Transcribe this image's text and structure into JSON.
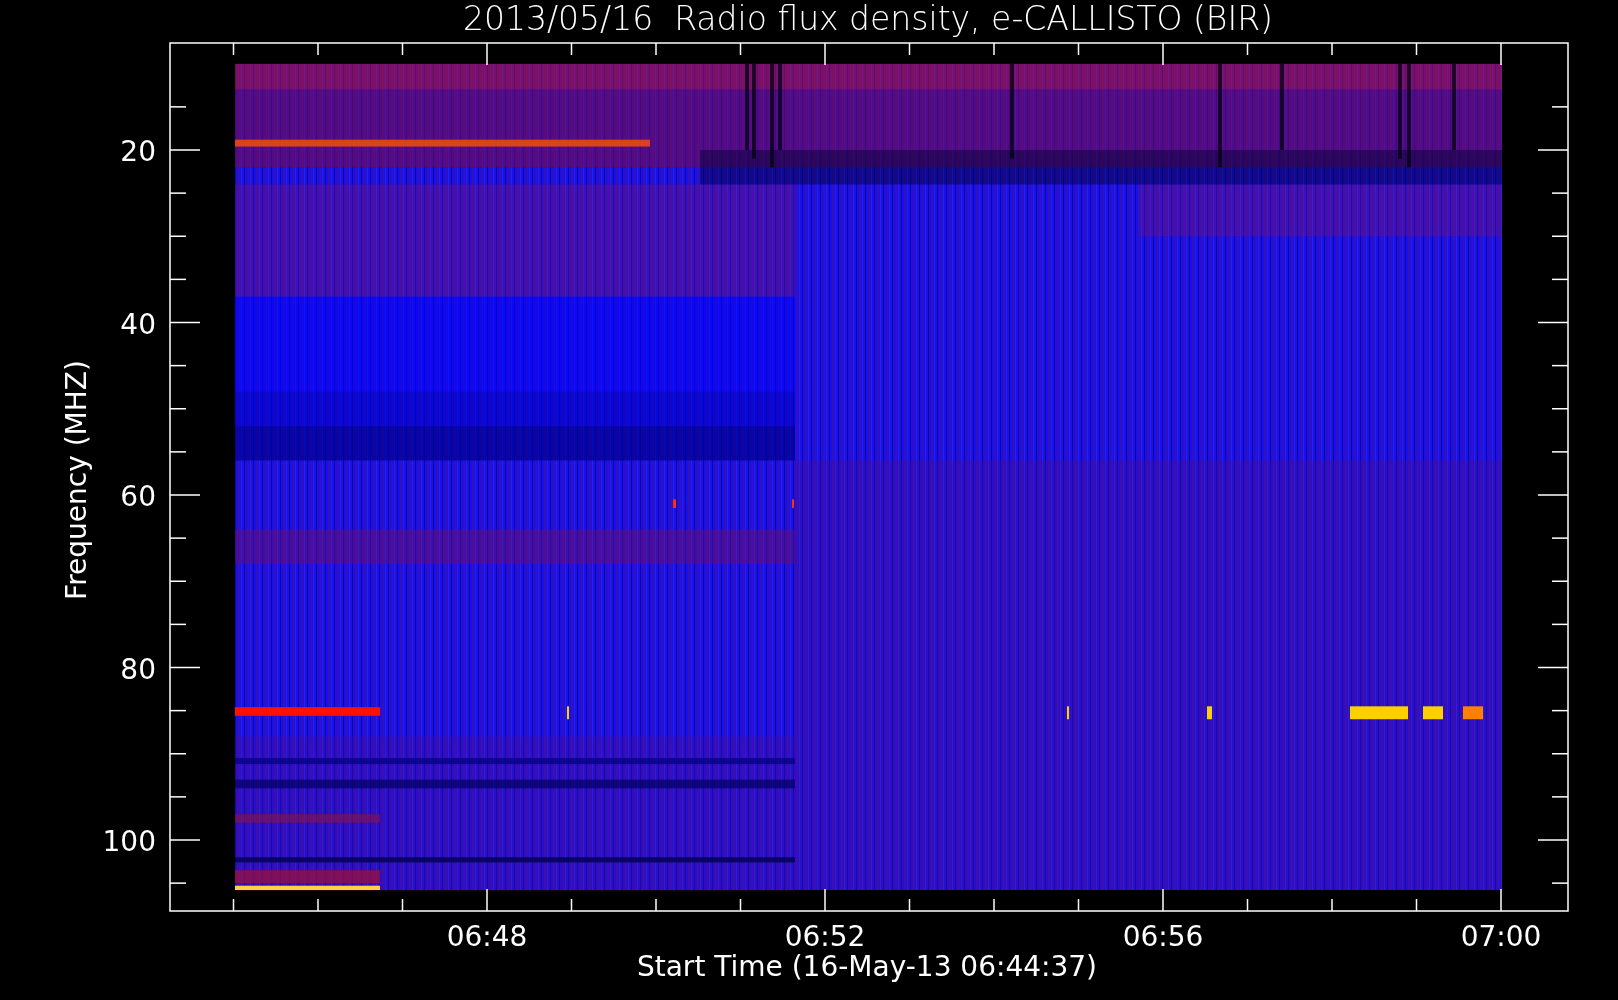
{
  "plot": {
    "title": "2013/05/16  Radio flux density, e-CALLISTO (BIR)",
    "xlabel": "Start Time (16-May-13 06:44:37)",
    "ylabel": "Frequency (MHZ)",
    "xticks": [
      "06:48",
      "06:52",
      "06:56",
      "07:00"
    ],
    "yticks": [
      "20",
      "40",
      "60",
      "80",
      "100"
    ]
  }
}
